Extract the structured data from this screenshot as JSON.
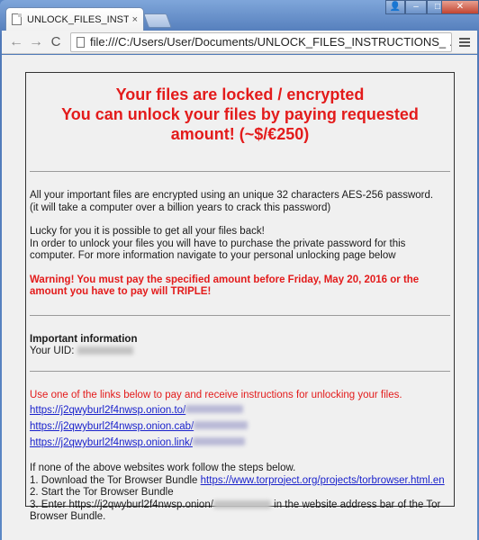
{
  "browser": {
    "tab_title": "UNLOCK_FILES_INSTRUCTI",
    "tab_close": "×",
    "address_prefix": "file:///C:/Users/User/Documents/UNLOCK_FILES_INSTRUCTIONS_",
    "address_suffix": ".h",
    "nav_back": "←",
    "nav_forward": "→",
    "nav_reload": "C",
    "win_min": "–",
    "win_max": "□",
    "win_close": "✕",
    "win_user": "👤"
  },
  "note": {
    "headline": "Your files are locked / encrypted\nYou can unlock your files by paying requested amount! (~$/€250)",
    "p1": "All your important files are encrypted using an unique 32 characters AES-256 password.\n(it will take a computer over a billion years to crack this password)",
    "p2": "Lucky for you it is possible to get all your files back!\nIn order to unlock your files you will have to purchase the private password for this computer. For more information navigate to your personal unlocking page below",
    "warning": "Warning! You must pay the specified amount before Friday, May 20, 2016 or the amount you have to pay will TRIPLE!",
    "info_title": "Important information",
    "uid_label": "Your UID:",
    "links_intro": "Use one of the links below to pay and receive instructions for unlocking your files.",
    "links": [
      "https://j2qwyburl2f4nwsp.onion.to/",
      "https://j2qwyburl2f4nwsp.onion.cab/",
      "https://j2qwyburl2f4nwsp.onion.link/"
    ],
    "fallback_intro": "If none of the above websites work follow the steps below.",
    "step1_prefix": "1. Download the Tor Browser Bundle ",
    "step1_link": "https://www.torproject.org/projects/torbrowser.html.en",
    "step2": "2. Start the Tor Browser Bundle",
    "step3_prefix": "3. Enter https://j2qwyburl2f4nwsp.onion/",
    "step3_suffix": " in the website address bar of the Tor Browser Bundle."
  }
}
